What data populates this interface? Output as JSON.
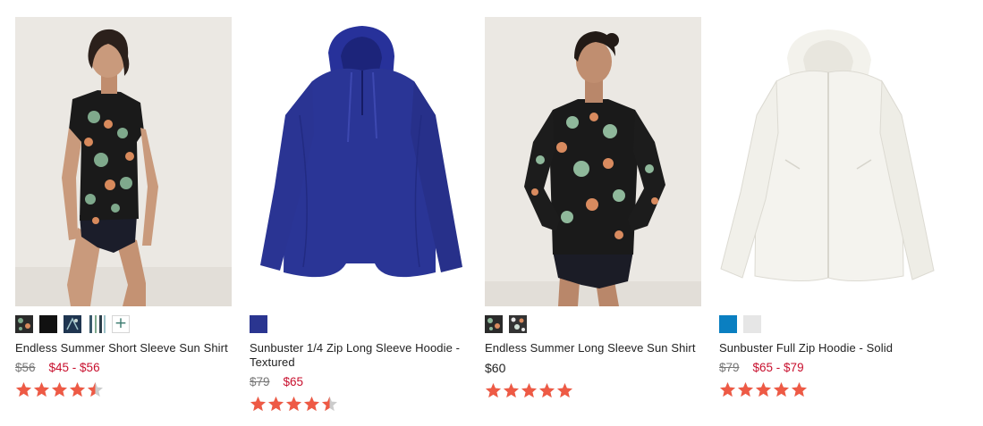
{
  "products": [
    {
      "name": "Endless Summer Short Sleeve Sun Shirt",
      "price_was": "$56",
      "price_now": "$45 - $56",
      "rating": 4.5,
      "swatches": [
        {
          "icon": "dark-floral-print",
          "color": "#2a2a2a"
        },
        {
          "icon": "solid",
          "color": "#111111"
        },
        {
          "icon": "navy-palm-print",
          "color": "#1f3550"
        },
        {
          "icon": "stripe-print",
          "color": "#3b5a6b"
        }
      ],
      "more_label": "+"
    },
    {
      "name": "Sunbuster 1/4 Zip Long Sleeve Hoodie - Textured",
      "price_was": "$79",
      "price_now": "$65",
      "rating": 4.5,
      "swatches": [
        {
          "icon": "solid",
          "color": "#2a3590"
        }
      ]
    },
    {
      "name": "Endless Summer Long Sleeve Sun Shirt",
      "price_regular": "$60",
      "rating": 5,
      "swatches": [
        {
          "icon": "dark-floral-print",
          "color": "#2a2a2a"
        },
        {
          "icon": "dark-floral-print",
          "color": "#333333"
        }
      ]
    },
    {
      "name": "Sunbuster Full Zip Hoodie - Solid",
      "price_was": "$79",
      "price_now": "$65 - $79",
      "rating": 5,
      "swatches": [
        {
          "icon": "solid",
          "color": "#0a7fc1"
        },
        {
          "icon": "solid",
          "color": "#e6e6e6"
        }
      ]
    }
  ],
  "colors": {
    "sale_price": "#c8102e",
    "star": "#ee5a45",
    "star_empty": "#cccccc"
  }
}
